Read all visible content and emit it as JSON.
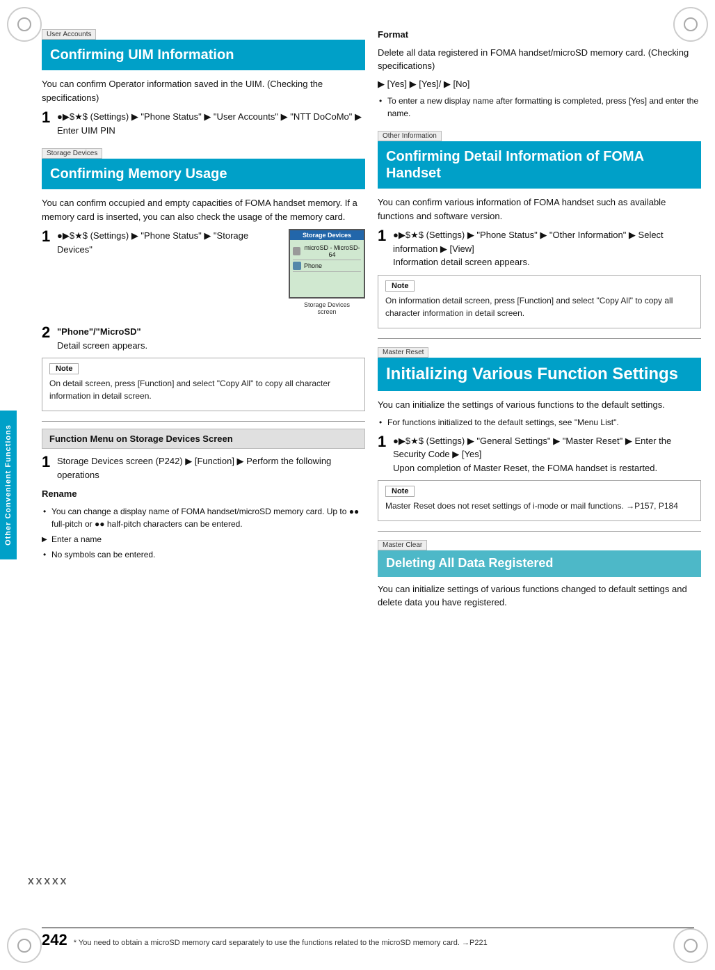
{
  "page": {
    "number": "242",
    "footnote": "* You need to obtain a microSD memory card separately to use the functions related to the microSD memory card. →P221"
  },
  "side_label": "Other Convenient Functions",
  "left_col": {
    "section1": {
      "tag": "User Accounts",
      "header": "Confirming UIM Information",
      "body": "You can confirm Operator information saved in the UIM. (Checking the specifications)",
      "step1": {
        "num": "1",
        "text": "●▶$★$ (Settings) ▶ \"Phone Status\" ▶ \"User Accounts\" ▶ \"NTT DoCoMo\" ▶ Enter UIM PIN"
      }
    },
    "section2": {
      "tag": "Storage Devices",
      "header": "Confirming Memory Usage",
      "body": "You can confirm occupied and empty capacities of FOMA handset memory. If a memory card is inserted, you can also check the usage of the memory card.",
      "step1": {
        "num": "1",
        "text": "●▶$★$ (Settings) ▶ \"Phone Status\" ▶ \"Storage Devices\""
      },
      "screen": {
        "title": "Storage Devices",
        "row1": "microSD - MicroSD-64",
        "row2": "Phone",
        "label": "Storage Devices\nscreen"
      },
      "step2": {
        "num": "2",
        "text": "\"Phone\"/\"MicroSD\"",
        "sub": "Detail screen appears."
      },
      "note": {
        "label": "Note",
        "text": "On detail screen, press [Function] and select \"Copy All\" to copy all character information in detail screen."
      }
    },
    "section3": {
      "header": "Function Menu on Storage Devices Screen",
      "step1": {
        "num": "1",
        "text": "Storage Devices screen (P242) ▶ [Function] ▶ Perform the following operations"
      },
      "rename": {
        "label": "Rename",
        "bullets": [
          "You can change a display name of FOMA handset/microSD memory card. Up to ●● full-pitch or ●● half-pitch characters can be entered.",
          "Enter a name",
          "No symbols can be entered."
        ]
      }
    }
  },
  "right_col": {
    "format_section": {
      "label": "Format",
      "body": "Delete all data registered in FOMA handset/microSD memory card. (Checking specifications)",
      "key_seq": "▶ [Yes] ▶ [Yes]/ ▶ [No]",
      "note": "To enter a new display name after formatting is completed, press [Yes] and enter the name."
    },
    "section1": {
      "tag": "Other Information",
      "header": "Confirming Detail Information of FOMA Handset",
      "body": "You can confirm various information of FOMA handset such as available functions and software version.",
      "step1": {
        "num": "1",
        "text": "●▶$★$ (Settings) ▶ \"Phone Status\" ▶ \"Other Information\" ▶ Select information ▶ [View]",
        "sub": "Information detail screen appears."
      },
      "note": {
        "label": "Note",
        "text": "On information detail screen, press [Function] and select \"Copy All\" to copy all character information in detail screen."
      }
    },
    "section2": {
      "tag": "Master Reset",
      "header": "Initializing Various Function Settings",
      "body": "You can initialize the settings of various functions to the default settings.",
      "bullets": [
        "For functions initialized to the default settings, see \"Menu List\"."
      ],
      "step1": {
        "num": "1",
        "text": "●▶$★$ (Settings) ▶ \"General Settings\" ▶ \"Master Reset\" ▶ Enter the Security Code ▶ [Yes]",
        "sub": "Upon completion of Master Reset, the FOMA handset is restarted."
      },
      "note": {
        "label": "Note",
        "text": "Master Reset does not reset settings of i-mode or mail functions. →P157, P184"
      }
    },
    "section3": {
      "tag": "Master Clear",
      "header": "Deleting All Data Registered",
      "body": "You can initialize settings of various functions changed to default settings and delete data you have registered."
    }
  }
}
